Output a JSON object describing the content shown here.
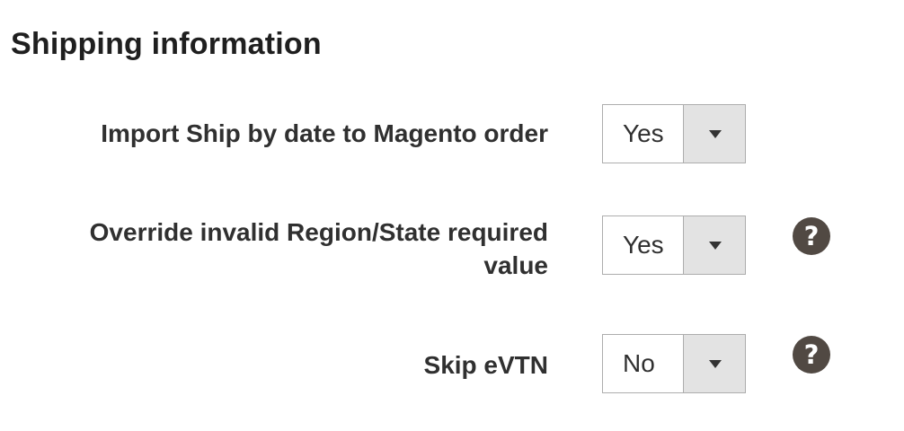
{
  "section": {
    "title": "Shipping information"
  },
  "fields": [
    {
      "label": "Import Ship by date to Magento order",
      "value": "Yes",
      "has_help": false
    },
    {
      "label": "Override invalid Region/State required value",
      "value": "Yes",
      "has_help": true,
      "help_symbol": "?"
    },
    {
      "label": "Skip eVTN",
      "value": "No",
      "has_help": true,
      "help_symbol": "?"
    }
  ],
  "colors": {
    "help_icon_bg": "#514943",
    "select_button_bg": "#e3e3e3",
    "select_border": "#adadad",
    "text": "#303030"
  },
  "icons": {
    "select_arrow": "chevron-down-icon",
    "help": "question-mark-icon"
  }
}
